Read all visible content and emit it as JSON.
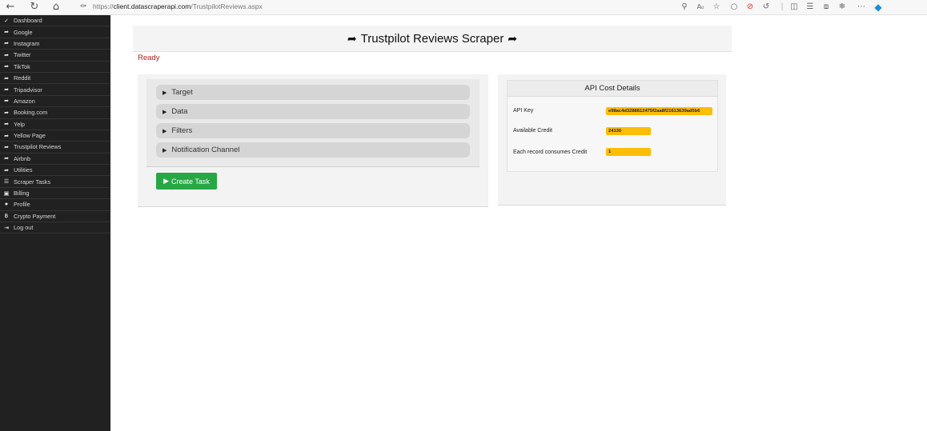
{
  "browser": {
    "url_prefix": "https://",
    "url_host": "client.datascraperapi.com",
    "url_path": "/TrustpilotReviews.aspx"
  },
  "sidebar": {
    "items": [
      {
        "label": "Dashboard",
        "icon": "check-icon"
      },
      {
        "label": "Google",
        "icon": "paper-plane-icon"
      },
      {
        "label": "Instagram",
        "icon": "paper-plane-icon"
      },
      {
        "label": "Twitter",
        "icon": "paper-plane-icon"
      },
      {
        "label": "TikTok",
        "icon": "paper-plane-icon"
      },
      {
        "label": "Reddit",
        "icon": "paper-plane-icon"
      },
      {
        "label": "Tripadvisor",
        "icon": "paper-plane-icon"
      },
      {
        "label": "Amazon",
        "icon": "paper-plane-icon"
      },
      {
        "label": "Booking.com",
        "icon": "paper-plane-icon"
      },
      {
        "label": "Yelp",
        "icon": "paper-plane-icon"
      },
      {
        "label": "Yellow Page",
        "icon": "paper-plane-icon"
      },
      {
        "label": "Trustpilot Reviews",
        "icon": "paper-plane-icon"
      },
      {
        "label": "Airbnb",
        "icon": "paper-plane-icon"
      },
      {
        "label": "Utilities",
        "icon": "paper-plane-icon"
      },
      {
        "label": "Scraper Tasks",
        "icon": "task-list-icon"
      },
      {
        "label": "Billing",
        "icon": "money-icon"
      },
      {
        "label": "Profile",
        "icon": "user-icon"
      },
      {
        "label": "Crypto Payment",
        "icon": "bitcoin-icon"
      },
      {
        "label": "Log out",
        "icon": "logout-icon"
      }
    ]
  },
  "header": {
    "title": "Trustpilot Reviews Scraper"
  },
  "status": {
    "text": "Ready"
  },
  "form": {
    "sections": [
      "Target",
      "Data",
      "Filters",
      "Notification Channel"
    ],
    "create_label": "Create Task"
  },
  "api": {
    "title": "API Cost Details",
    "key_label": "API Key",
    "key_value": "e98ac4d3288812475f2aa8f21613639ad5b6",
    "credit_label": "Available Credit",
    "credit_value": "24130",
    "consume_label": "Each record consumes Credit",
    "consume_value": "1"
  },
  "colors": {
    "sidebar_bg": "#212121",
    "status_red": "#b11b1b",
    "button_green": "#28a745",
    "highlight_yellow": "#fbbd05"
  }
}
